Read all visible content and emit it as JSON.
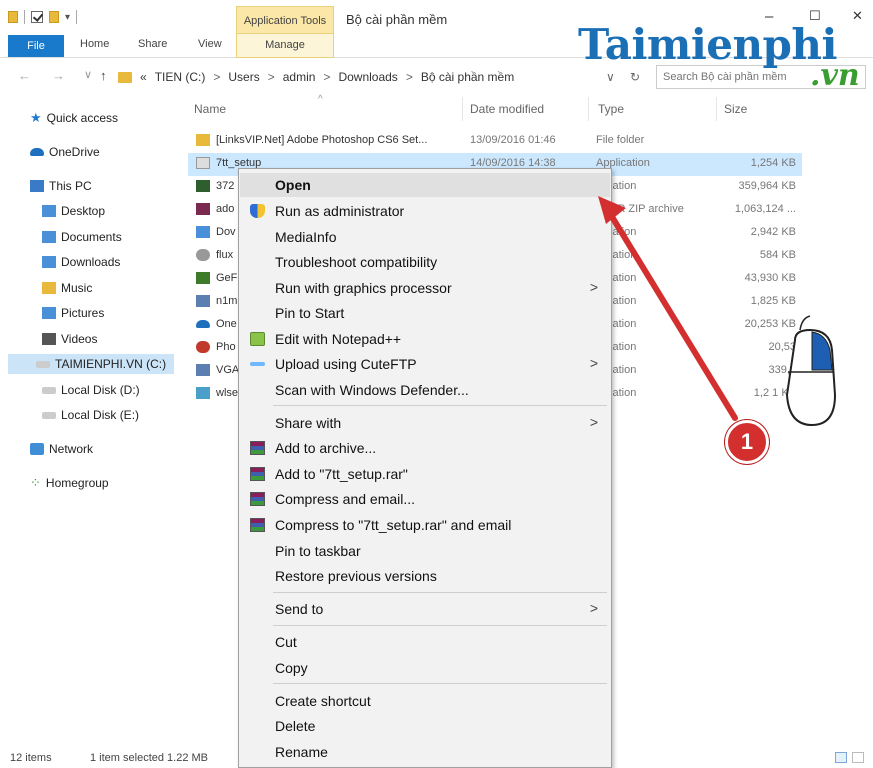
{
  "titlebar": {
    "contextual_tab_group": "Application Tools",
    "window_title": "Bộ cài phần mềm",
    "minimize": "–",
    "maximize": "☐",
    "close": "✕"
  },
  "ribbon": {
    "tabs": [
      "File",
      "Home",
      "Share",
      "View",
      "Manage"
    ]
  },
  "address": {
    "back": "←",
    "forward": "→",
    "up": "↑",
    "overflow": "«",
    "crumbs": [
      "TIEN (C:)",
      "Users",
      "admin",
      "Downloads",
      "Bộ cài phần mềm"
    ],
    "separator": ">",
    "dropdown": "∨",
    "refresh": "↻",
    "search_placeholder": "Search Bộ cài phần mềm"
  },
  "watermark": {
    "main": "Taimienphi",
    "suffix": ".vn"
  },
  "navpane": {
    "items": [
      {
        "label": "Quick access",
        "icon": "star-icon"
      },
      {
        "label": "OneDrive",
        "icon": "cloud-icon"
      },
      {
        "label": "This PC",
        "icon": "computer-icon"
      },
      {
        "label": "Desktop",
        "icon": "folder-icon"
      },
      {
        "label": "Documents",
        "icon": "documents-icon"
      },
      {
        "label": "Downloads",
        "icon": "downloads-icon"
      },
      {
        "label": "Music",
        "icon": "music-icon"
      },
      {
        "label": "Pictures",
        "icon": "pictures-icon"
      },
      {
        "label": "Videos",
        "icon": "videos-icon"
      },
      {
        "label": "TAIMIENPHI.VN (C:)",
        "icon": "drive-icon"
      },
      {
        "label": "Local Disk (D:)",
        "icon": "drive-icon"
      },
      {
        "label": "Local Disk (E:)",
        "icon": "drive-icon"
      },
      {
        "label": "Network",
        "icon": "network-icon"
      },
      {
        "label": "Homegroup",
        "icon": "homegroup-icon"
      }
    ]
  },
  "filelist": {
    "columns": {
      "name": "Name",
      "date": "Date modified",
      "type": "Type",
      "size": "Size"
    },
    "sort_indicator": "^",
    "rows": [
      {
        "name": "[LinksVIP.Net] Adobe Photoshop CS6 Set...",
        "date": "13/09/2016 01:46",
        "type": "File folder",
        "size": ""
      },
      {
        "name": "7tt_setup",
        "date": "14/09/2016 14:38",
        "type": "Application",
        "size": "1,254 KB"
      },
      {
        "name": "372",
        "date": "",
        "type": "plication",
        "size": "359,964 KB"
      },
      {
        "name": "ado",
        "date": "",
        "type": "nRAR ZIP archive",
        "size": "1,063,124 ..."
      },
      {
        "name": "Dov",
        "date": "",
        "type": "plication",
        "size": "2,942 KB"
      },
      {
        "name": "flux",
        "date": "",
        "type": "plication",
        "size": "584 KB"
      },
      {
        "name": "GeF",
        "date": "",
        "type": "plication",
        "size": "43,930 KB"
      },
      {
        "name": "n1m",
        "date": "",
        "type": "plication",
        "size": "1,825 KB"
      },
      {
        "name": "One",
        "date": "",
        "type": "plication",
        "size": "20,253 KB"
      },
      {
        "name": "Pho",
        "date": "",
        "type": "plication",
        "size": "20,53"
      },
      {
        "name": "VGA",
        "date": "",
        "type": "plication",
        "size": "339,9"
      },
      {
        "name": "wlse",
        "date": "",
        "type": "plication",
        "size": "1,2 1 KB"
      }
    ]
  },
  "context_menu": {
    "items": [
      {
        "label": "Open",
        "bold": true,
        "icon": "",
        "submenu": false
      },
      {
        "label": "Run as administrator",
        "icon": "shield-icon",
        "submenu": false
      },
      {
        "label": "MediaInfo",
        "icon": "",
        "submenu": false
      },
      {
        "label": "Troubleshoot compatibility",
        "icon": "",
        "submenu": false
      },
      {
        "label": "Run with graphics processor",
        "icon": "",
        "submenu": true
      },
      {
        "label": "Pin to Start",
        "icon": "",
        "submenu": false
      },
      {
        "label": "Edit with Notepad++",
        "icon": "notepadpp-icon",
        "submenu": false
      },
      {
        "label": "Upload using CuteFTP",
        "icon": "cuteftp-icon",
        "submenu": true
      },
      {
        "label": "Scan with Windows Defender...",
        "icon": "",
        "submenu": false
      },
      {
        "label": "Share with",
        "icon": "",
        "submenu": true
      },
      {
        "label": "Add to archive...",
        "icon": "winrar-icon",
        "submenu": false
      },
      {
        "label": "Add to \"7tt_setup.rar\"",
        "icon": "winrar-icon",
        "submenu": false
      },
      {
        "label": "Compress and email...",
        "icon": "winrar-icon",
        "submenu": false
      },
      {
        "label": "Compress to \"7tt_setup.rar\" and email",
        "icon": "winrar-icon",
        "submenu": false
      },
      {
        "label": "Pin to taskbar",
        "icon": "",
        "submenu": false
      },
      {
        "label": "Restore previous versions",
        "icon": "",
        "submenu": false
      },
      {
        "label": "Send to",
        "icon": "",
        "submenu": true
      },
      {
        "label": "Cut",
        "icon": "",
        "submenu": false
      },
      {
        "label": "Copy",
        "icon": "",
        "submenu": false
      },
      {
        "label": "Create shortcut",
        "icon": "",
        "submenu": false
      },
      {
        "label": "Delete",
        "icon": "",
        "submenu": false
      },
      {
        "label": "Rename",
        "icon": "",
        "submenu": false
      }
    ],
    "submenu_arrow": ">"
  },
  "statusbar": {
    "item_count": "12 items",
    "selection": "1 item selected  1.22 MB"
  },
  "annotation": {
    "step_number": "1",
    "color": "#d32f2f"
  },
  "colors": {
    "file_tab": "#1979ca",
    "selection": "#cce8ff",
    "contextual_tab": "#fbe7a8",
    "logo_blue": "#1a6fb5",
    "logo_green": "#3a9d2f"
  }
}
